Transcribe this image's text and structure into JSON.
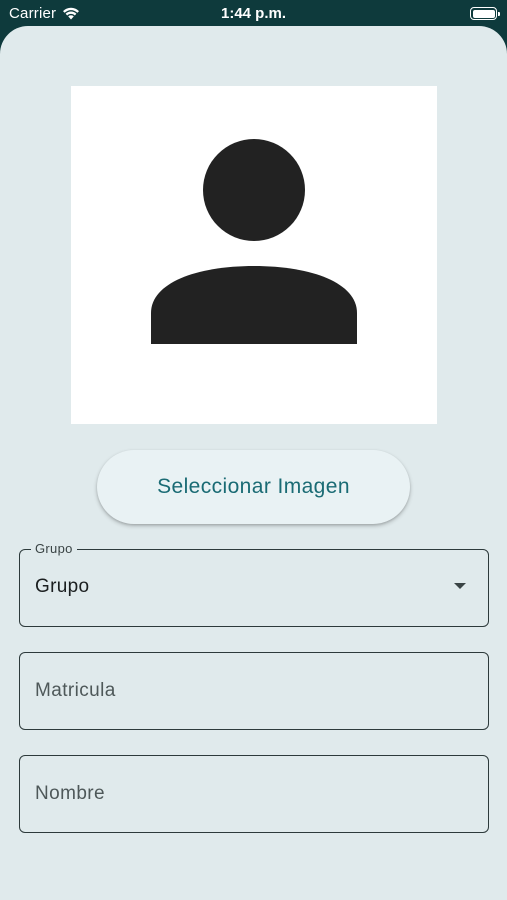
{
  "status_bar": {
    "carrier": "Carrier",
    "time": "1:44 p.m.",
    "wifi_icon": "wifi-icon",
    "battery_icon": "battery-icon"
  },
  "avatar": {
    "icon": "person-icon"
  },
  "select_image_button": {
    "label": "Seleccionar Imagen"
  },
  "form": {
    "grupo": {
      "label": "Grupo",
      "value": "Grupo",
      "icon": "dropdown-arrow-icon"
    },
    "matricula": {
      "placeholder": "Matricula",
      "value": ""
    },
    "nombre": {
      "placeholder": "Nombre",
      "value": ""
    }
  },
  "colors": {
    "status_bar_bg": "#0e3a3c",
    "sheet_bg": "#e0eaec",
    "button_text": "#1a6b74",
    "field_border": "#2d3a3b"
  }
}
